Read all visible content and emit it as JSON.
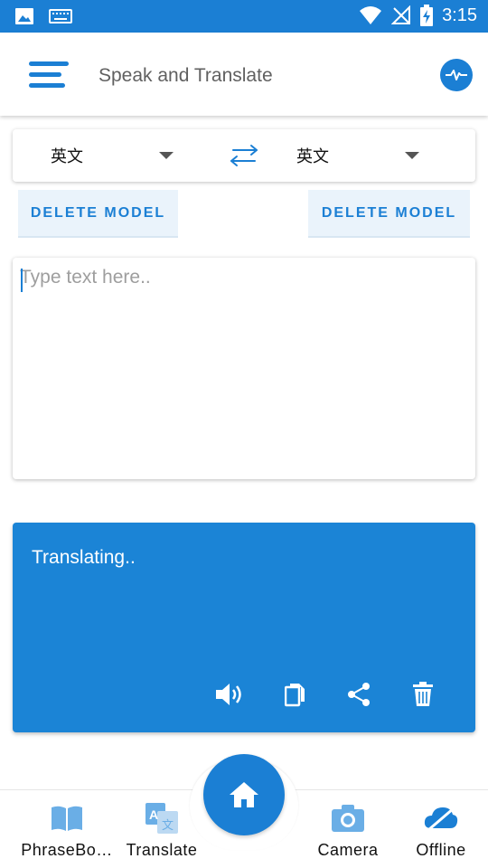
{
  "status_bar": {
    "time": "3:15",
    "icons": [
      "image-icon",
      "keyboard-icon",
      "wifi-icon",
      "no-signal-icon",
      "battery-charging-icon"
    ]
  },
  "app_bar": {
    "title": "Speak and Translate",
    "menu_icon": "menu-icon",
    "action_icon": "pulse-icon"
  },
  "language_selector": {
    "source_language": "英文",
    "target_language": "英文",
    "swap_icon": "swap-arrows-icon"
  },
  "model_buttons": {
    "left_label": "DELETE MODEL",
    "right_label": "DELETE MODEL"
  },
  "input": {
    "placeholder": "Type text here..",
    "value": ""
  },
  "output": {
    "text": "Translating..",
    "actions": [
      "speaker-icon",
      "copy-icon",
      "share-icon",
      "trash-icon"
    ]
  },
  "bottom_nav": {
    "items": [
      {
        "label": "PhraseBo…",
        "icon": "book-icon"
      },
      {
        "label": "Translate",
        "icon": "translate-icon"
      },
      {
        "label": "Camera",
        "icon": "camera-icon"
      },
      {
        "label": "Offline",
        "icon": "cloud-off-icon"
      }
    ],
    "fab_icon": "home-icon"
  },
  "colors": {
    "primary": "#1b7fd4",
    "output_background": "#1b84d6",
    "button_background": "#eaf3fb",
    "nav_icon_light": "#6aaee6"
  }
}
